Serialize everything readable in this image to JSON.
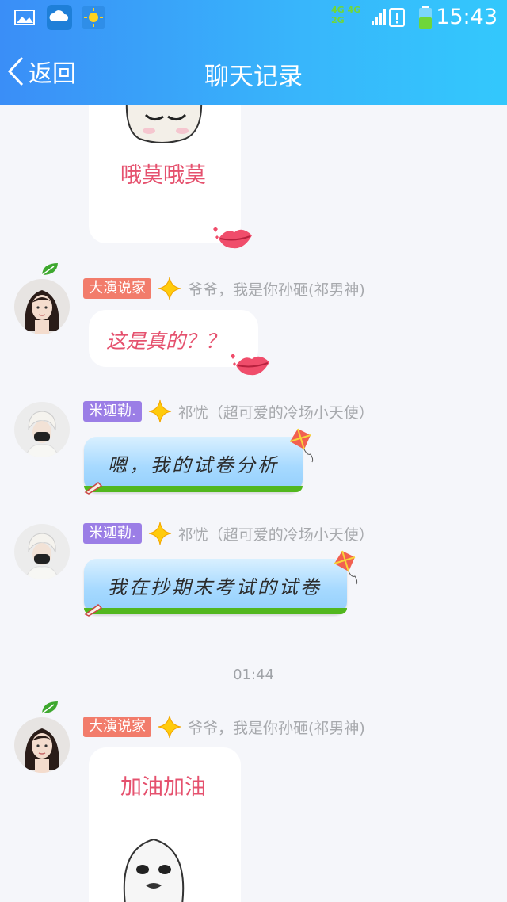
{
  "status_bar": {
    "time": "15:43",
    "network": [
      "4G 4G",
      "2G"
    ]
  },
  "nav": {
    "back_label": "返回",
    "title": "聊天记录"
  },
  "messages": [
    {
      "text": "哦莫哦莫"
    },
    {
      "tag": "大演说家",
      "nick": "爷爷，我是你孙砸(祁男神)",
      "text": "这是真的？？"
    },
    {
      "tag": "米迦勒.",
      "nick": "祁忧（超可爱的冷场小天使）",
      "text": "嗯，我的试卷分析"
    },
    {
      "tag": "米迦勒.",
      "nick": "祁忧（超可爱的冷场小天使）",
      "text": "我在抄期末考试的试卷"
    },
    {
      "tag": "大演说家",
      "nick": "爷爷，我是你孙砸(祁男神)",
      "text": "加油加油"
    }
  ],
  "time_separator": "01:44",
  "colors": {
    "header_start": "#3a8ef7",
    "header_end": "#33c8fc",
    "tag_orange": "#f27c6b",
    "tag_purple": "#9b7ee6",
    "pink_text": "#e5516e"
  }
}
